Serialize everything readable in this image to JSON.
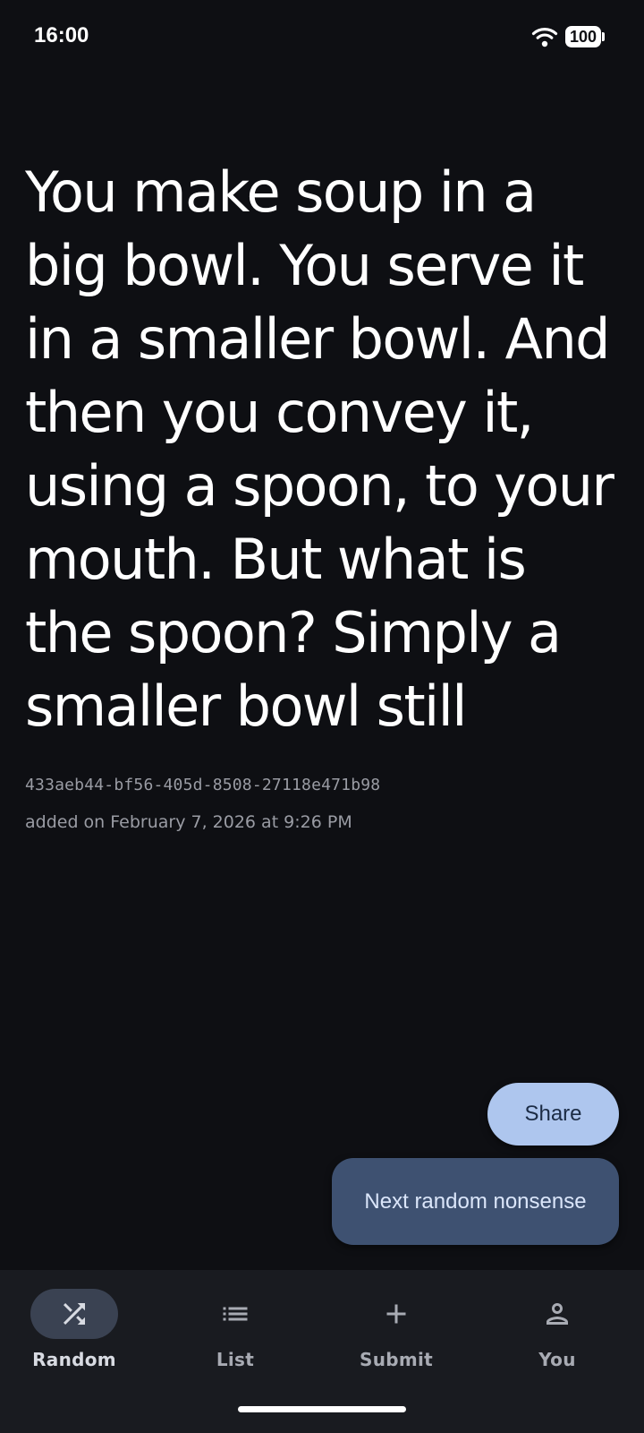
{
  "status_bar": {
    "time": "16:00",
    "battery": "100",
    "icons": [
      "wifi-icon",
      "battery-icon"
    ]
  },
  "quote": {
    "text": "You make soup in a big bowl. You serve it in a smaller bowl. And then you convey it, using a spoon, to your mouth. But what is the spoon? Simply a smaller bowl still",
    "id": "433aeb44-bf56-405d-8508-27118e471b98",
    "added": "added on February 7, 2026 at 9:26 PM"
  },
  "actions": {
    "share_label": "Share",
    "next_label": "Next random nonsense"
  },
  "bottom_nav": {
    "items": [
      {
        "label": "Random",
        "icon": "shuffle-icon",
        "active": true
      },
      {
        "label": "List",
        "icon": "list-icon",
        "active": false
      },
      {
        "label": "Submit",
        "icon": "plus-icon",
        "active": false
      },
      {
        "label": "You",
        "icon": "person-icon",
        "active": false
      }
    ]
  },
  "colors": {
    "background": "#0e0f13",
    "share_button": "#aec6ee",
    "next_button": "#3e5171",
    "nav_background": "#191b20",
    "nav_active_pill": "#3a4252"
  }
}
